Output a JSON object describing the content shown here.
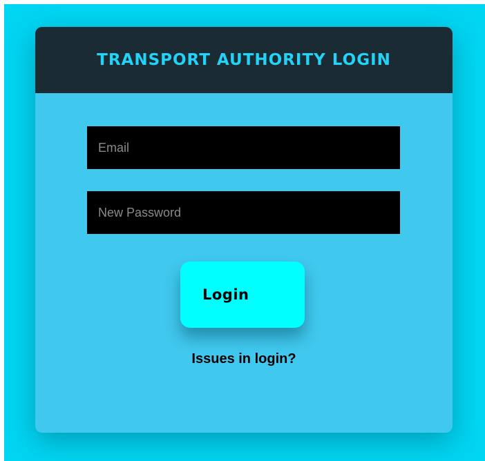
{
  "login_card": {
    "title": "TRANSPORT AUTHORITY LOGIN",
    "email_placeholder": "Email",
    "password_placeholder": "New Password",
    "login_button_label": "Login",
    "issues_link_label": "Issues in login?"
  },
  "colors": {
    "page_background": "#00d5f2",
    "card_background": "#40c8ee",
    "header_background": "#1a2b33",
    "title_text": "#22d3f7",
    "input_background": "#000000",
    "button_background": "#00ffff"
  }
}
